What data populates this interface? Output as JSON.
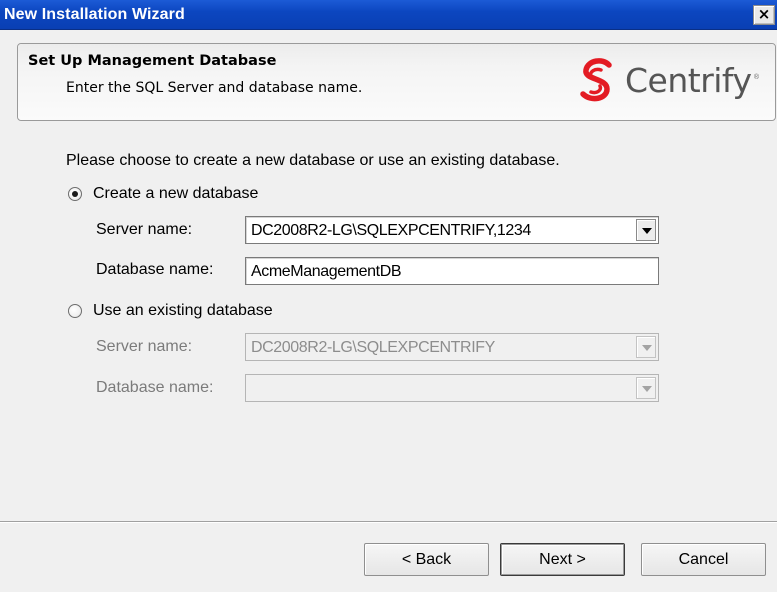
{
  "window": {
    "title": "New Installation Wizard",
    "close_label": "×"
  },
  "header": {
    "title": "Set Up Management Database",
    "subtitle": "Enter the SQL Server and database name.",
    "logo_text": "Centrify",
    "logo_reg": "®",
    "logo_color": "#e31b23"
  },
  "main": {
    "prompt": "Please choose to create a new database or use an existing database.",
    "create_new": {
      "label": "Create a new database",
      "selected": true,
      "server_label": "Server name:",
      "server_value": "DC2008R2-LG\\SQLEXPCENTRIFY,1234",
      "database_label": "Database name:",
      "database_value": "AcmeManagementDB"
    },
    "use_existing": {
      "label": "Use an existing database",
      "selected": false,
      "server_label": "Server name:",
      "server_value": "DC2008R2-LG\\SQLEXPCENTRIFY",
      "database_label": "Database name:",
      "database_value": ""
    }
  },
  "footer": {
    "back_label": "< Back",
    "next_label": "Next >",
    "cancel_label": "Cancel"
  }
}
